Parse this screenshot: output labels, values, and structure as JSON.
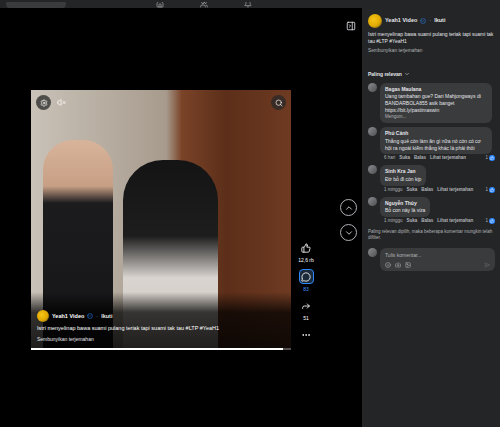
{
  "post": {
    "page": "Yeah1 Video",
    "verified": true,
    "separator": "·",
    "follow": "Ikuti",
    "caption": "Istri menyelinap bawa suami pulang teriak tapi suami tak tau #LTP #YeaH1",
    "translation_toggle": "Sembunyikan terjemahan"
  },
  "player": {
    "muted": true,
    "progress": {
      "level": 0.97
    }
  },
  "actions": [
    {
      "kind": "like",
      "count": "12,6 rb",
      "selected": false
    },
    {
      "kind": "comment",
      "count": "83",
      "selected": true
    },
    {
      "kind": "share",
      "count": "51",
      "selected": false
    }
  ],
  "comments_sort": {
    "label": "Paling relevan"
  },
  "comments": [
    {
      "author": "Bagas Maulana",
      "text": "Uang tambahan gue? Dari Mahjongways di BANDARBOLA855 asik banget https://bit.ly/pastimaswin",
      "preview": "Mengom...",
      "time": "",
      "actions": [],
      "reactions": ""
    },
    {
      "author": "Phú Cảnh",
      "text": "Thằng quê còn làm ăn gì nữa nó còn có cơ hội ra ngoài kiếm thằng khác là phải thôi",
      "preview": "",
      "time": "6 hari",
      "actions": [
        "Suka",
        "Balas",
        "Lihat terjemahan"
      ],
      "reactions": "1"
    },
    {
      "author": "Sinh Kra Jan",
      "text": "Đờ bỏ đi còn kịp",
      "preview": "",
      "time": "1 minggu",
      "actions": [
        "Suka",
        "Balas",
        "Lihat terjemahan"
      ],
      "reactions": "1"
    },
    {
      "author": "Nguyễn Thủy",
      "text": "Bỏ con này là vừa",
      "preview": "",
      "time": "1 minggu",
      "actions": [
        "Suka",
        "Balas",
        "Lihat terjemahan"
      ],
      "reactions": "1"
    }
  ],
  "filter_note": "Paling relevan dipilih, maka beberapa komentar mungkin telah difilter.",
  "composer": {
    "placeholder": "Tulis komentar..."
  }
}
